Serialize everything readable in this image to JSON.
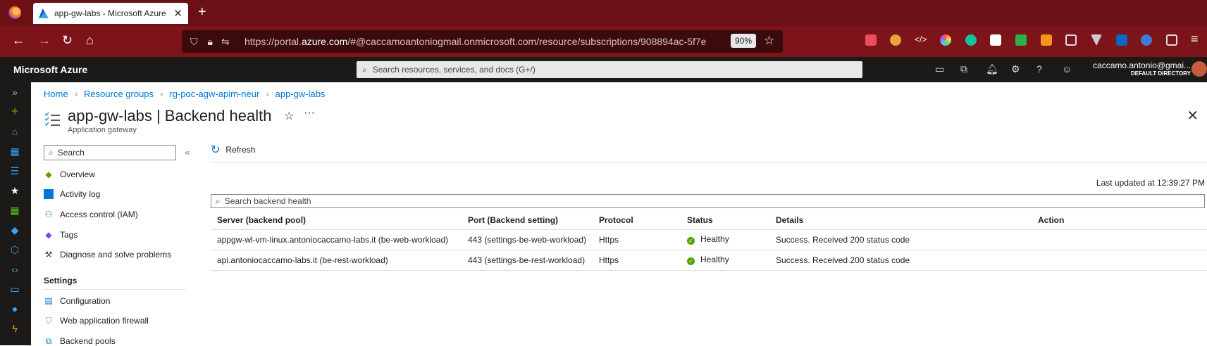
{
  "browser": {
    "tab_title": "app-gw-labs - Microsoft Azure",
    "tab_close": "✕",
    "new_tab": "+",
    "url_prefix": "https://portal.",
    "url_domain": "azure.com",
    "url_rest": "/#@caccamoantoniogmail.onmicrosoft.com/resource/subscriptions/908894ac-5f7e",
    "zoom": "90%",
    "extension_icons": [
      "pocket-icon",
      "extension-icon",
      "code-icon",
      "color-icon",
      "grammarly-icon",
      "book-icon",
      "wh-icon",
      "fire-icon",
      "library-icon",
      "vue-icon",
      "linkedin-icon",
      "shield-icon",
      "puzzle-icon",
      "menu-icon"
    ]
  },
  "azure": {
    "brand": "Microsoft Azure",
    "search_placeholder": "Search resources, services, and docs (G+/)",
    "account_name": "caccamo.antonio@gmai...",
    "account_directory": "DEFAULT DIRECTORY"
  },
  "breadcrumb": [
    "Home",
    "Resource groups",
    "rg-poc-agw-apim-neur",
    "app-gw-labs"
  ],
  "page": {
    "title": "app-gw-labs | Backend health",
    "subtitle": "Application gateway"
  },
  "menu": {
    "search_placeholder": "Search",
    "items": [
      {
        "label": "Overview",
        "icon": "overview-icon"
      },
      {
        "label": "Activity log",
        "icon": "activity-log-icon"
      },
      {
        "label": "Access control (IAM)",
        "icon": "iam-icon"
      },
      {
        "label": "Tags",
        "icon": "tag-icon"
      },
      {
        "label": "Diagnose and solve problems",
        "icon": "wrench-icon"
      }
    ],
    "section_settings": "Settings",
    "settings_items": [
      {
        "label": "Configuration",
        "icon": "configuration-icon"
      },
      {
        "label": "Web application firewall",
        "icon": "shield-icon"
      },
      {
        "label": "Backend pools",
        "icon": "backend-pools-icon"
      }
    ]
  },
  "toolbar": {
    "refresh_label": "Refresh"
  },
  "content": {
    "last_updated": "Last updated at 12:39:27 PM",
    "search_placeholder": "Search backend health",
    "columns": [
      "Server (backend pool)",
      "Port (Backend setting)",
      "Protocol",
      "Status",
      "Details",
      "Action"
    ],
    "rows": [
      {
        "server": "appgw-wl-vm-linux.antoniocaccamo-labs.it (be-web-workload)",
        "port": "443 (settings-be-web-workload)",
        "protocol": "Https",
        "status": "Healthy",
        "details": "Success. Received 200 status code",
        "action": ""
      },
      {
        "server": "api.antoniocaccamo-labs.it (be-rest-workload)",
        "port": "443 (settings-be-rest-workload)",
        "protocol": "Https",
        "status": "Healthy",
        "details": "Success. Received 200 status code",
        "action": ""
      }
    ]
  },
  "colors": {
    "tabbar": "#6b1015",
    "navbar": "#7c141a",
    "azure_bar": "#1b1a19",
    "link": "#0078d4",
    "healthy": "#57a300"
  }
}
